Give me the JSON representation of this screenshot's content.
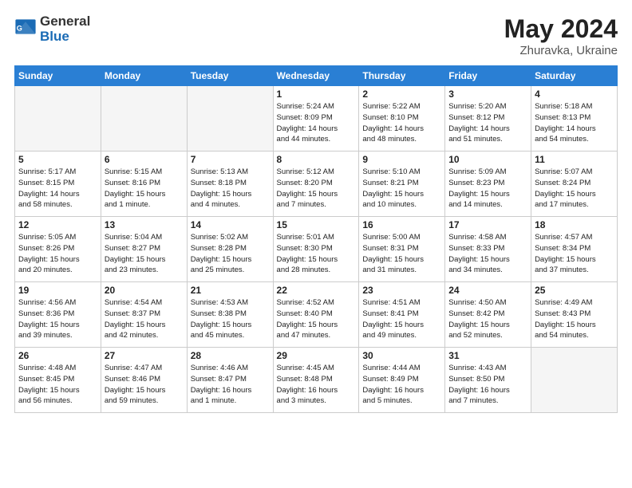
{
  "logo": {
    "general": "General",
    "blue": "Blue"
  },
  "title": {
    "month_year": "May 2024",
    "location": "Zhuravka, Ukraine"
  },
  "days_of_week": [
    "Sunday",
    "Monday",
    "Tuesday",
    "Wednesday",
    "Thursday",
    "Friday",
    "Saturday"
  ],
  "weeks": [
    [
      {
        "day": "",
        "info": ""
      },
      {
        "day": "",
        "info": ""
      },
      {
        "day": "",
        "info": ""
      },
      {
        "day": "1",
        "info": "Sunrise: 5:24 AM\nSunset: 8:09 PM\nDaylight: 14 hours\nand 44 minutes."
      },
      {
        "day": "2",
        "info": "Sunrise: 5:22 AM\nSunset: 8:10 PM\nDaylight: 14 hours\nand 48 minutes."
      },
      {
        "day": "3",
        "info": "Sunrise: 5:20 AM\nSunset: 8:12 PM\nDaylight: 14 hours\nand 51 minutes."
      },
      {
        "day": "4",
        "info": "Sunrise: 5:18 AM\nSunset: 8:13 PM\nDaylight: 14 hours\nand 54 minutes."
      }
    ],
    [
      {
        "day": "5",
        "info": "Sunrise: 5:17 AM\nSunset: 8:15 PM\nDaylight: 14 hours\nand 58 minutes."
      },
      {
        "day": "6",
        "info": "Sunrise: 5:15 AM\nSunset: 8:16 PM\nDaylight: 15 hours\nand 1 minute."
      },
      {
        "day": "7",
        "info": "Sunrise: 5:13 AM\nSunset: 8:18 PM\nDaylight: 15 hours\nand 4 minutes."
      },
      {
        "day": "8",
        "info": "Sunrise: 5:12 AM\nSunset: 8:20 PM\nDaylight: 15 hours\nand 7 minutes."
      },
      {
        "day": "9",
        "info": "Sunrise: 5:10 AM\nSunset: 8:21 PM\nDaylight: 15 hours\nand 10 minutes."
      },
      {
        "day": "10",
        "info": "Sunrise: 5:09 AM\nSunset: 8:23 PM\nDaylight: 15 hours\nand 14 minutes."
      },
      {
        "day": "11",
        "info": "Sunrise: 5:07 AM\nSunset: 8:24 PM\nDaylight: 15 hours\nand 17 minutes."
      }
    ],
    [
      {
        "day": "12",
        "info": "Sunrise: 5:05 AM\nSunset: 8:26 PM\nDaylight: 15 hours\nand 20 minutes."
      },
      {
        "day": "13",
        "info": "Sunrise: 5:04 AM\nSunset: 8:27 PM\nDaylight: 15 hours\nand 23 minutes."
      },
      {
        "day": "14",
        "info": "Sunrise: 5:02 AM\nSunset: 8:28 PM\nDaylight: 15 hours\nand 25 minutes."
      },
      {
        "day": "15",
        "info": "Sunrise: 5:01 AM\nSunset: 8:30 PM\nDaylight: 15 hours\nand 28 minutes."
      },
      {
        "day": "16",
        "info": "Sunrise: 5:00 AM\nSunset: 8:31 PM\nDaylight: 15 hours\nand 31 minutes."
      },
      {
        "day": "17",
        "info": "Sunrise: 4:58 AM\nSunset: 8:33 PM\nDaylight: 15 hours\nand 34 minutes."
      },
      {
        "day": "18",
        "info": "Sunrise: 4:57 AM\nSunset: 8:34 PM\nDaylight: 15 hours\nand 37 minutes."
      }
    ],
    [
      {
        "day": "19",
        "info": "Sunrise: 4:56 AM\nSunset: 8:36 PM\nDaylight: 15 hours\nand 39 minutes."
      },
      {
        "day": "20",
        "info": "Sunrise: 4:54 AM\nSunset: 8:37 PM\nDaylight: 15 hours\nand 42 minutes."
      },
      {
        "day": "21",
        "info": "Sunrise: 4:53 AM\nSunset: 8:38 PM\nDaylight: 15 hours\nand 45 minutes."
      },
      {
        "day": "22",
        "info": "Sunrise: 4:52 AM\nSunset: 8:40 PM\nDaylight: 15 hours\nand 47 minutes."
      },
      {
        "day": "23",
        "info": "Sunrise: 4:51 AM\nSunset: 8:41 PM\nDaylight: 15 hours\nand 49 minutes."
      },
      {
        "day": "24",
        "info": "Sunrise: 4:50 AM\nSunset: 8:42 PM\nDaylight: 15 hours\nand 52 minutes."
      },
      {
        "day": "25",
        "info": "Sunrise: 4:49 AM\nSunset: 8:43 PM\nDaylight: 15 hours\nand 54 minutes."
      }
    ],
    [
      {
        "day": "26",
        "info": "Sunrise: 4:48 AM\nSunset: 8:45 PM\nDaylight: 15 hours\nand 56 minutes."
      },
      {
        "day": "27",
        "info": "Sunrise: 4:47 AM\nSunset: 8:46 PM\nDaylight: 15 hours\nand 59 minutes."
      },
      {
        "day": "28",
        "info": "Sunrise: 4:46 AM\nSunset: 8:47 PM\nDaylight: 16 hours\nand 1 minute."
      },
      {
        "day": "29",
        "info": "Sunrise: 4:45 AM\nSunset: 8:48 PM\nDaylight: 16 hours\nand 3 minutes."
      },
      {
        "day": "30",
        "info": "Sunrise: 4:44 AM\nSunset: 8:49 PM\nDaylight: 16 hours\nand 5 minutes."
      },
      {
        "day": "31",
        "info": "Sunrise: 4:43 AM\nSunset: 8:50 PM\nDaylight: 16 hours\nand 7 minutes."
      },
      {
        "day": "",
        "info": ""
      }
    ]
  ]
}
